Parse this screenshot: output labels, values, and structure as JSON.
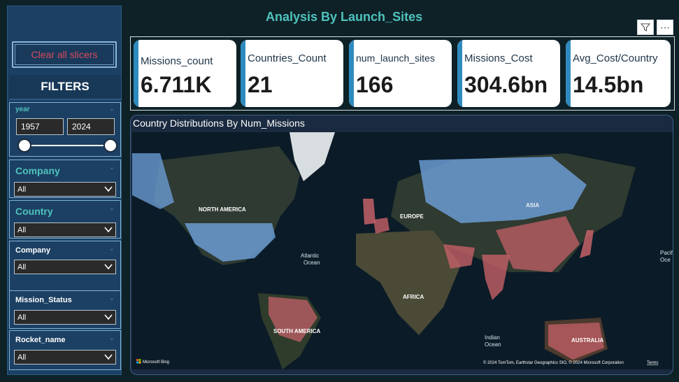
{
  "header": {
    "title": "Analysis By Launch_Sites"
  },
  "toolbar": {
    "filter_icon": "filter-icon",
    "more_icon": "more-options-icon",
    "more_glyph": "⋯"
  },
  "sidebar": {
    "clear_label": "Clear all slicers",
    "filters_heading": "FILTERS",
    "year": {
      "title": "year",
      "from": "1957",
      "to": "2024"
    },
    "slicers": [
      {
        "title": "Company",
        "value": "All"
      },
      {
        "title": "Country",
        "value": "All"
      },
      {
        "title": "Company",
        "value": "All"
      },
      {
        "title": "Mission_Status",
        "value": "All"
      },
      {
        "title": "Rocket_name",
        "value": "All"
      }
    ]
  },
  "kpis": [
    {
      "label": "Missions_count",
      "value": "6.711K"
    },
    {
      "label": "Countries_Count",
      "value": "21"
    },
    {
      "label": "num_launch_sites",
      "value": "166"
    },
    {
      "label": "Missions_Cost",
      "value": "304.6bn"
    },
    {
      "label": "Avg_Cost/Country",
      "value": "14.5bn"
    }
  ],
  "map": {
    "title": "Country Distributions By Num_Missions",
    "labels": {
      "north_america": "NORTH AMERICA",
      "europe": "EUROPE",
      "asia": "ASIA",
      "africa": "AFRICA",
      "south_america": "SOUTH AMERICA",
      "australia": "AUSTRALIA",
      "atlantic_1": "Atlantic",
      "atlantic_2": "Ocean",
      "indian_1": "Indian",
      "indian_2": "Ocean",
      "pacific_1": "Pacif",
      "pacific_2": "Oce"
    },
    "bing_logo": "Microsoft Bing",
    "attribution": "© 2024 TomTom, Earthstar Geographics SIO, © 2024 Microsoft Corporation",
    "terms": "Terms"
  },
  "colors": {
    "title": "#4fc3bd",
    "kpi_accent": "#2f8bbf",
    "map_blue": "#6fa3dd",
    "map_red": "#c46067",
    "clear_text": "#d84a5c"
  }
}
